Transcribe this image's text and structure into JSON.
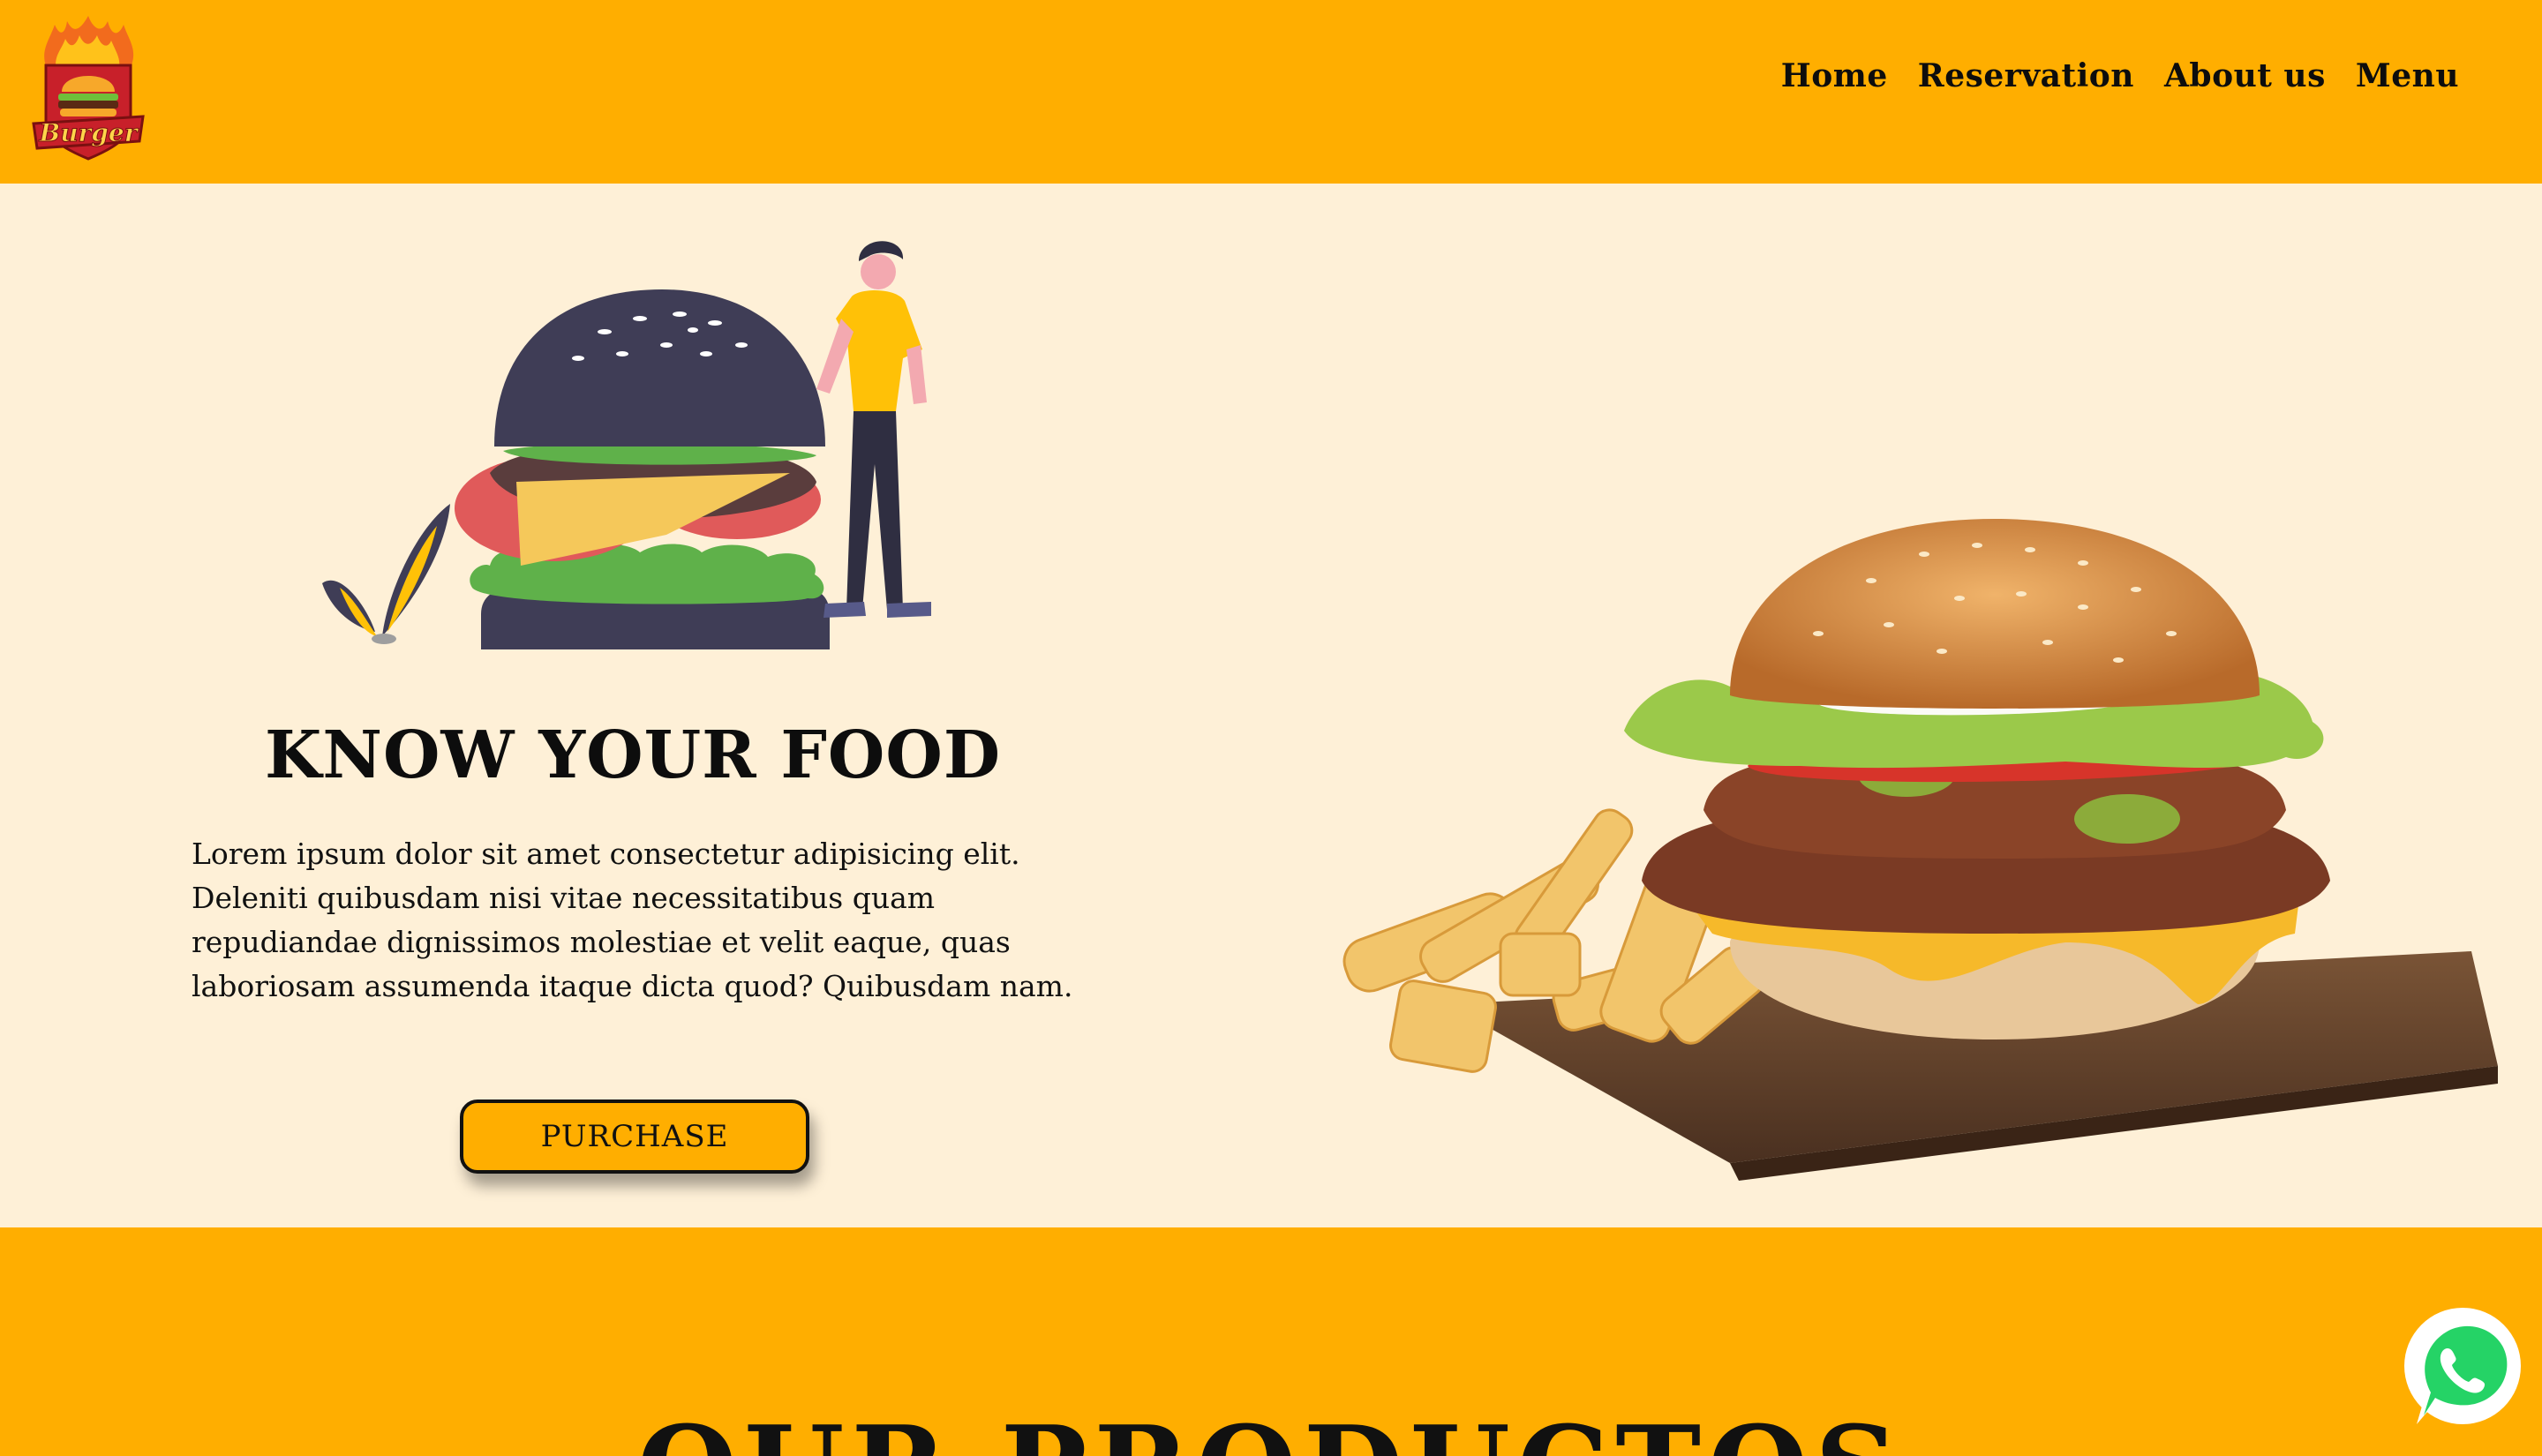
{
  "brand": {
    "logo_text": "Burger"
  },
  "nav": {
    "items": [
      {
        "label": "Home"
      },
      {
        "label": "Reservation"
      },
      {
        "label": "About us"
      },
      {
        "label": "Menu"
      }
    ]
  },
  "hero": {
    "title": "KNOW YOUR FOOD",
    "description": "Lorem ipsum dolor sit amet consectetur adipisicing elit. Deleniti quibusdam nisi vitae necessitatibus quam repudiandae dignissimos molestiae et velit eaque, quas laboriosam assumenda itaque dicta quod? Quibusdam nam.",
    "cta_label": "PURCHASE"
  },
  "products": {
    "title": "OUR PRODUCTOS"
  },
  "icons": {
    "logo": "burger-logo-icon",
    "illustration": "burger-person-illustration",
    "photo": "burger-fries-photo",
    "whatsapp": "whatsapp-icon"
  },
  "colors": {
    "accent": "#ffae00",
    "background": "#fef0d7",
    "text": "#0d0d0d",
    "whatsapp": "#25d366"
  }
}
